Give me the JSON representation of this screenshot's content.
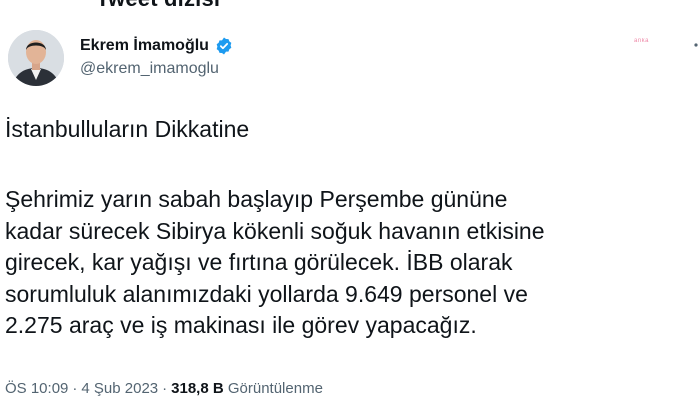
{
  "header": {
    "partial_title": "Tweet dizisi"
  },
  "author": {
    "name": "Ekrem İmamoğlu",
    "handle": "@ekrem_imamoglu",
    "verified_color": "#1d9bf0"
  },
  "watermark": {
    "text": "anka"
  },
  "tweet": {
    "title": "İstanbulluların Dikkatine",
    "body_lines": [
      "Şehrimiz yarın sabah başlayıp Perşembe gününe",
      "kadar sürecek Sibirya kökenli soğuk havanın etkisine",
      "girecek, kar yağışı ve fırtına görülecek. İBB olarak",
      "sorumluluk alanımızdaki yollarda 9.649 personel ve",
      "2.275 araç ve iş makinası ile görev yapacağız."
    ]
  },
  "meta": {
    "time": "ÖS 10:09",
    "separator": "·",
    "date": "4 Şub 2023",
    "views_count": "318,8 B",
    "views_label": "Görüntülenme"
  },
  "icons": {
    "verified": "verified-badge-icon",
    "more": "more-options-icon"
  }
}
